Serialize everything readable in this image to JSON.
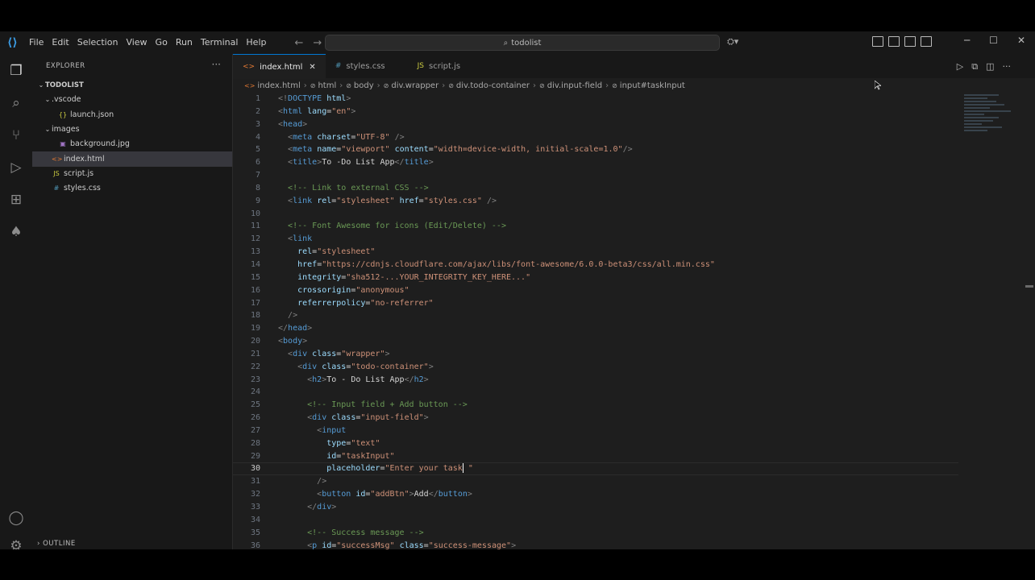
{
  "menu": [
    "File",
    "Edit",
    "Selection",
    "View",
    "Go",
    "Run",
    "Terminal",
    "Help"
  ],
  "search": {
    "text": "todolist"
  },
  "explorer": {
    "title": "EXPLORER",
    "dots": "···",
    "outline": "OUTLINE"
  },
  "tree": [
    {
      "label": "TODOLIST",
      "depth": 0,
      "kind": "folder-open",
      "bold": true
    },
    {
      "label": ".vscode",
      "depth": 1,
      "kind": "folder-open"
    },
    {
      "label": "launch.json",
      "depth": 2,
      "kind": "json"
    },
    {
      "label": "images",
      "depth": 1,
      "kind": "folder-open"
    },
    {
      "label": "background.jpg",
      "depth": 2,
      "kind": "image"
    },
    {
      "label": "index.html",
      "depth": 1,
      "kind": "html",
      "selected": true
    },
    {
      "label": "script.js",
      "depth": 1,
      "kind": "js"
    },
    {
      "label": "styles.css",
      "depth": 1,
      "kind": "css"
    }
  ],
  "tabs": [
    {
      "label": "index.html",
      "kind": "html",
      "active": true
    },
    {
      "label": "styles.css",
      "kind": "css"
    },
    {
      "label": "script.js",
      "kind": "js"
    }
  ],
  "breadcrumb": [
    "index.html",
    "html",
    "body",
    "div.wrapper",
    "div.todo-container",
    "div.input-field",
    "input#taskInput"
  ],
  "current_line": 30,
  "code": [
    {
      "n": "1",
      "t": [
        [
          "pn",
          "<!"
        ],
        [
          "tg",
          "DOCTYPE "
        ],
        [
          "at",
          "html"
        ],
        [
          "pn",
          ">"
        ]
      ]
    },
    {
      "n": "2",
      "t": [
        [
          "pn",
          "<"
        ],
        [
          "tg",
          "html "
        ],
        [
          "at",
          "lang"
        ],
        [
          "tx",
          "="
        ],
        [
          "st",
          "\"en\""
        ],
        [
          "pn",
          ">"
        ]
      ]
    },
    {
      "n": "3",
      "t": [
        [
          "pn",
          "<"
        ],
        [
          "tg",
          "head"
        ],
        [
          "pn",
          ">"
        ]
      ]
    },
    {
      "n": "4",
      "t": [
        [
          "tx",
          "  "
        ],
        [
          "pn",
          "<"
        ],
        [
          "tg",
          "meta "
        ],
        [
          "at",
          "charset"
        ],
        [
          "tx",
          "="
        ],
        [
          "st",
          "\"UTF-8\""
        ],
        [
          "tx",
          " "
        ],
        [
          "pn",
          "/>"
        ]
      ]
    },
    {
      "n": "5",
      "t": [
        [
          "tx",
          "  "
        ],
        [
          "pn",
          "<"
        ],
        [
          "tg",
          "meta "
        ],
        [
          "at",
          "name"
        ],
        [
          "tx",
          "="
        ],
        [
          "st",
          "\"viewport\""
        ],
        [
          "tx",
          " "
        ],
        [
          "at",
          "content"
        ],
        [
          "tx",
          "="
        ],
        [
          "st",
          "\"width=device-width, initial-scale=1.0\""
        ],
        [
          "pn",
          "/>"
        ]
      ]
    },
    {
      "n": "6",
      "t": [
        [
          "tx",
          "  "
        ],
        [
          "pn",
          "<"
        ],
        [
          "tg",
          "title"
        ],
        [
          "pn",
          ">"
        ],
        [
          "tx",
          "To -Do List App"
        ],
        [
          "pn",
          "</"
        ],
        [
          "tg",
          "title"
        ],
        [
          "pn",
          ">"
        ]
      ]
    },
    {
      "n": "7",
      "t": []
    },
    {
      "n": "8",
      "t": [
        [
          "tx",
          "  "
        ],
        [
          "cm",
          "<!-- Link to external CSS -->"
        ]
      ]
    },
    {
      "n": "9",
      "t": [
        [
          "tx",
          "  "
        ],
        [
          "pn",
          "<"
        ],
        [
          "tg",
          "link "
        ],
        [
          "at",
          "rel"
        ],
        [
          "tx",
          "="
        ],
        [
          "st",
          "\"stylesheet\""
        ],
        [
          "tx",
          " "
        ],
        [
          "at",
          "href"
        ],
        [
          "tx",
          "="
        ],
        [
          "st",
          "\"styles.css\""
        ],
        [
          "tx",
          " "
        ],
        [
          "pn",
          "/>"
        ]
      ]
    },
    {
      "n": "10",
      "t": []
    },
    {
      "n": "11",
      "t": [
        [
          "tx",
          "  "
        ],
        [
          "cm",
          "<!-- Font Awesome for icons (Edit/Delete) -->"
        ]
      ]
    },
    {
      "n": "12",
      "t": [
        [
          "tx",
          "  "
        ],
        [
          "pn",
          "<"
        ],
        [
          "tg",
          "link"
        ]
      ]
    },
    {
      "n": "13",
      "t": [
        [
          "tx",
          "    "
        ],
        [
          "at",
          "rel"
        ],
        [
          "tx",
          "="
        ],
        [
          "st",
          "\"stylesheet\""
        ]
      ]
    },
    {
      "n": "14",
      "t": [
        [
          "tx",
          "    "
        ],
        [
          "at",
          "href"
        ],
        [
          "tx",
          "="
        ],
        [
          "st",
          "\"https://cdnjs.cloudflare.com/ajax/libs/font-awesome/6.0.0-beta3/css/all.min.css\""
        ]
      ]
    },
    {
      "n": "15",
      "t": [
        [
          "tx",
          "    "
        ],
        [
          "at",
          "integrity"
        ],
        [
          "tx",
          "="
        ],
        [
          "st",
          "\"sha512-...YOUR_INTEGRITY_KEY_HERE...\""
        ]
      ]
    },
    {
      "n": "16",
      "t": [
        [
          "tx",
          "    "
        ],
        [
          "at",
          "crossorigin"
        ],
        [
          "tx",
          "="
        ],
        [
          "st",
          "\"anonymous\""
        ]
      ]
    },
    {
      "n": "17",
      "t": [
        [
          "tx",
          "    "
        ],
        [
          "at",
          "referrerpolicy"
        ],
        [
          "tx",
          "="
        ],
        [
          "st",
          "\"no-referrer\""
        ]
      ]
    },
    {
      "n": "18",
      "t": [
        [
          "tx",
          "  "
        ],
        [
          "pn",
          "/>"
        ]
      ]
    },
    {
      "n": "19",
      "t": [
        [
          "pn",
          "</"
        ],
        [
          "tg",
          "head"
        ],
        [
          "pn",
          ">"
        ]
      ]
    },
    {
      "n": "20",
      "t": [
        [
          "pn",
          "<"
        ],
        [
          "tg",
          "body"
        ],
        [
          "pn",
          ">"
        ]
      ]
    },
    {
      "n": "21",
      "t": [
        [
          "tx",
          "  "
        ],
        [
          "pn",
          "<"
        ],
        [
          "tg",
          "div "
        ],
        [
          "at",
          "class"
        ],
        [
          "tx",
          "="
        ],
        [
          "st",
          "\"wrapper\""
        ],
        [
          "pn",
          ">"
        ]
      ]
    },
    {
      "n": "22",
      "t": [
        [
          "tx",
          "    "
        ],
        [
          "pn",
          "<"
        ],
        [
          "tg",
          "div "
        ],
        [
          "at",
          "class"
        ],
        [
          "tx",
          "="
        ],
        [
          "st",
          "\"todo-container\""
        ],
        [
          "pn",
          ">"
        ]
      ]
    },
    {
      "n": "23",
      "t": [
        [
          "tx",
          "      "
        ],
        [
          "pn",
          "<"
        ],
        [
          "tg",
          "h2"
        ],
        [
          "pn",
          ">"
        ],
        [
          "tx",
          "To - Do List App"
        ],
        [
          "pn",
          "</"
        ],
        [
          "tg",
          "h2"
        ],
        [
          "pn",
          ">"
        ]
      ]
    },
    {
      "n": "24",
      "t": []
    },
    {
      "n": "25",
      "t": [
        [
          "tx",
          "      "
        ],
        [
          "cm",
          "<!-- Input field + Add button -->"
        ]
      ]
    },
    {
      "n": "26",
      "t": [
        [
          "tx",
          "      "
        ],
        [
          "pn",
          "<"
        ],
        [
          "tg",
          "div "
        ],
        [
          "at",
          "class"
        ],
        [
          "tx",
          "="
        ],
        [
          "st",
          "\"input-field\""
        ],
        [
          "pn",
          ">"
        ]
      ]
    },
    {
      "n": "27",
      "t": [
        [
          "tx",
          "        "
        ],
        [
          "pn",
          "<"
        ],
        [
          "tg",
          "input"
        ]
      ]
    },
    {
      "n": "28",
      "t": [
        [
          "tx",
          "          "
        ],
        [
          "at",
          "type"
        ],
        [
          "tx",
          "="
        ],
        [
          "st",
          "\"text\""
        ]
      ]
    },
    {
      "n": "29",
      "t": [
        [
          "tx",
          "          "
        ],
        [
          "at",
          "id"
        ],
        [
          "tx",
          "="
        ],
        [
          "st",
          "\"taskInput\""
        ]
      ]
    },
    {
      "n": "30",
      "t": [
        [
          "tx",
          "          "
        ],
        [
          "at",
          "placeholder"
        ],
        [
          "tx",
          "="
        ],
        [
          "st",
          "\"Enter your task"
        ],
        [
          "cur",
          ""
        ],
        [
          "st",
          " \""
        ]
      ]
    },
    {
      "n": "31",
      "t": [
        [
          "tx",
          "        "
        ],
        [
          "pn",
          "/>"
        ]
      ]
    },
    {
      "n": "32",
      "t": [
        [
          "tx",
          "        "
        ],
        [
          "pn",
          "<"
        ],
        [
          "tg",
          "button "
        ],
        [
          "at",
          "id"
        ],
        [
          "tx",
          "="
        ],
        [
          "st",
          "\"addBtn\""
        ],
        [
          "pn",
          ">"
        ],
        [
          "tx",
          "Add"
        ],
        [
          "pn",
          "</"
        ],
        [
          "tg",
          "button"
        ],
        [
          "pn",
          ">"
        ]
      ]
    },
    {
      "n": "33",
      "t": [
        [
          "tx",
          "      "
        ],
        [
          "pn",
          "</"
        ],
        [
          "tg",
          "div"
        ],
        [
          "pn",
          ">"
        ]
      ]
    },
    {
      "n": "34",
      "t": []
    },
    {
      "n": "35",
      "t": [
        [
          "tx",
          "      "
        ],
        [
          "cm",
          "<!-- Success message -->"
        ]
      ]
    },
    {
      "n": "36",
      "t": [
        [
          "tx",
          "      "
        ],
        [
          "pn",
          "<"
        ],
        [
          "tg",
          "p "
        ],
        [
          "at",
          "id"
        ],
        [
          "tx",
          "="
        ],
        [
          "st",
          "\"successMsg\""
        ],
        [
          "tx",
          " "
        ],
        [
          "at",
          "class"
        ],
        [
          "tx",
          "="
        ],
        [
          "st",
          "\"success-message\""
        ],
        [
          "pn",
          ">"
        ]
      ]
    }
  ]
}
